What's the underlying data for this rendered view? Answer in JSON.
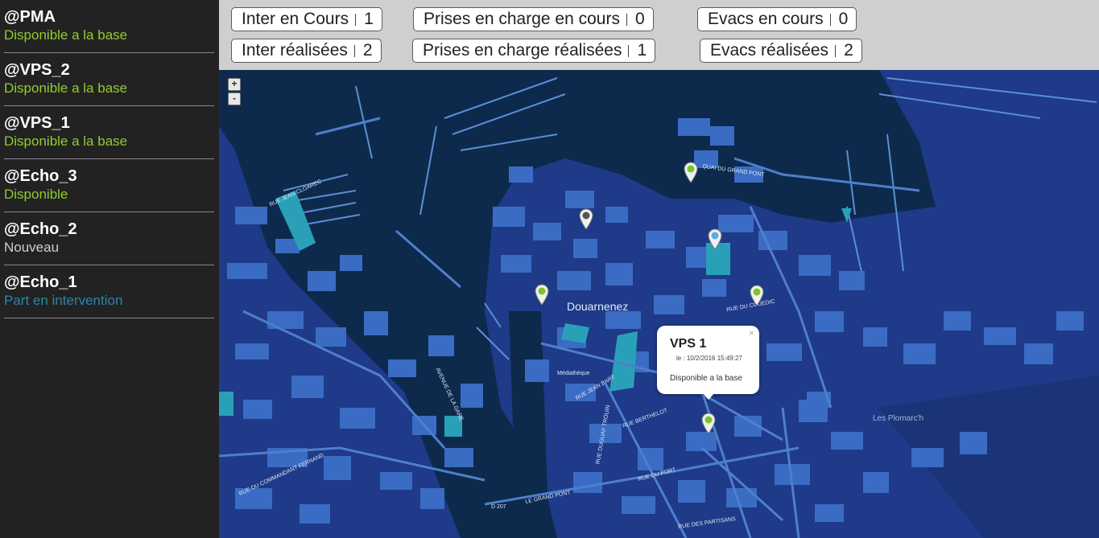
{
  "units": [
    {
      "name": "@PMA",
      "status": "Disponible a la base",
      "status_color": "#8fcc2e"
    },
    {
      "name": "@VPS_2",
      "status": "Disponible a la base",
      "status_color": "#8fcc2e"
    },
    {
      "name": "@VPS_1",
      "status": "Disponible a la base",
      "status_color": "#8fcc2e"
    },
    {
      "name": "@Echo_3",
      "status": "Disponible",
      "status_color": "#8fcc2e"
    },
    {
      "name": "@Echo_2",
      "status": "Nouveau",
      "status_color": "#cfcfcf"
    },
    {
      "name": "@Echo_1",
      "status": "Part en intervention",
      "status_color": "#2a86a8"
    }
  ],
  "counters": {
    "inter_en_cours": {
      "label": "Inter en Cours",
      "value": "1"
    },
    "prises_en_cours": {
      "label": "Prises en charge en cours",
      "value": "0"
    },
    "evacs_en_cours": {
      "label": "Evacs en cours",
      "value": "0"
    },
    "inter_realisees": {
      "label": "Inter réalisées",
      "value": "2"
    },
    "prises_realisees": {
      "label": "Prises en charge réalisées",
      "value": "1"
    },
    "evacs_realisees": {
      "label": "Evacs réalisées",
      "value": "2"
    }
  },
  "map": {
    "zoom_in": "+",
    "zoom_out": "-",
    "city_label": "Douarnenez",
    "place_label": "Les Plomarc'h",
    "streets": {
      "s1": "RUE JEAN CLOAREC",
      "s2": "QUAI DU GRAND PONT",
      "s3": "RUE DU COUEDIC",
      "s4": "AVENUE DE LA GARE",
      "s5": "RUE JEAN BART",
      "s6": "RUE BERTHELOT",
      "s7": "RUE DU PORT",
      "s8": "RUE DES PARTISANS",
      "s9": "LE GRAND PONT",
      "s10": "RUE DU COMMANDANT FERNAND",
      "s11": "D 207",
      "s12": "RUE DUGUAY TROUIN",
      "s13": "Médiathèque"
    },
    "colors": {
      "water": "#0d2a4d",
      "land": "#1e3a88",
      "building": "#3a6cc4",
      "park": "#2aa0b8"
    },
    "popup": {
      "title": "VPS 1",
      "date": "le : 10/2/2016 15:49:27",
      "text": "Disponible a la base",
      "close": "×"
    }
  }
}
